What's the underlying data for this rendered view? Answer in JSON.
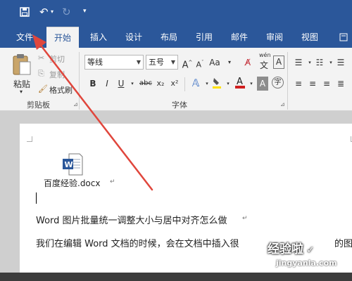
{
  "quick_access": {
    "save_icon": "save-icon",
    "undo_icon": "undo-icon",
    "redo_icon": "redo-icon",
    "customize_icon": "customize-qat-icon"
  },
  "tabs": [
    {
      "label": "文件"
    },
    {
      "label": "开始"
    },
    {
      "label": "插入"
    },
    {
      "label": "设计"
    },
    {
      "label": "布局"
    },
    {
      "label": "引用"
    },
    {
      "label": "邮件"
    },
    {
      "label": "审阅"
    },
    {
      "label": "视图"
    }
  ],
  "clipboard": {
    "paste_label": "粘贴",
    "cut_label": "剪切",
    "copy_label": "复制",
    "format_painter_label": "格式刷",
    "group_label": "剪贴板"
  },
  "font": {
    "font_name": "等线",
    "font_size": "五号",
    "group_label": "字体",
    "buttons": [
      "B",
      "I",
      "U",
      "abc",
      "x₂",
      "x²"
    ],
    "wen": "wén",
    "wen_char": "文",
    "box_a": "A"
  },
  "document": {
    "file_name": "百度经验.docx",
    "title_line": "Word 图片批量统一调整大小与居中对齐怎么做",
    "body_line": "我们在编辑 Word 文档的时候，会在文档中插入很",
    "body_tail": "的图"
  },
  "watermark": {
    "main": "经验啦",
    "url": "jingyanla.com"
  },
  "colors": {
    "brand": "#2b579a",
    "arrow": "#e0463c"
  }
}
